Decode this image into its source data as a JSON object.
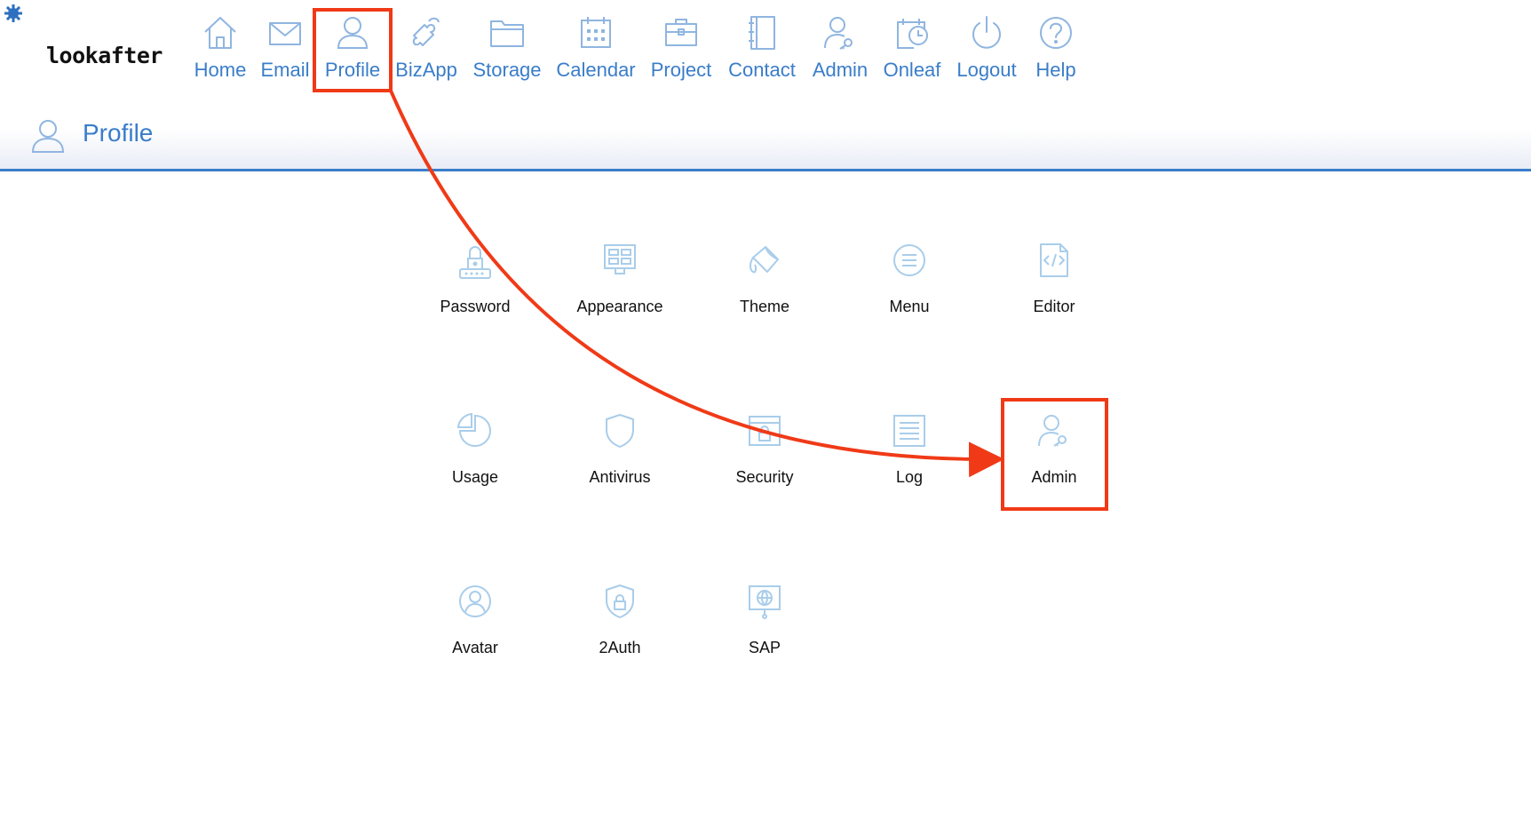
{
  "app": {
    "logo": "lookafter"
  },
  "nav": {
    "items": [
      {
        "label": "Home",
        "icon": "home-icon"
      },
      {
        "label": "Email",
        "icon": "envelope-icon"
      },
      {
        "label": "Profile",
        "icon": "user-icon"
      },
      {
        "label": "BizApp",
        "icon": "puzzle-icon"
      },
      {
        "label": "Storage",
        "icon": "folder-icon"
      },
      {
        "label": "Calendar",
        "icon": "calendar-icon"
      },
      {
        "label": "Project",
        "icon": "briefcase-icon"
      },
      {
        "label": "Contact",
        "icon": "address-book-icon"
      },
      {
        "label": "Admin",
        "icon": "user-key-icon"
      },
      {
        "label": "Onleaf",
        "icon": "calendar-clock-icon"
      },
      {
        "label": "Logout",
        "icon": "power-icon"
      },
      {
        "label": "Help",
        "icon": "question-icon"
      }
    ]
  },
  "page": {
    "title": "Profile",
    "title_icon": "user-icon"
  },
  "tiles": [
    {
      "label": "Password",
      "icon": "password-lock-icon"
    },
    {
      "label": "Appearance",
      "icon": "monitor-layout-icon"
    },
    {
      "label": "Theme",
      "icon": "paint-bucket-icon"
    },
    {
      "label": "Menu",
      "icon": "menu-circle-icon"
    },
    {
      "label": "Editor",
      "icon": "code-file-icon"
    },
    {
      "label": "Usage",
      "icon": "pie-chart-icon"
    },
    {
      "label": "Antivirus",
      "icon": "shield-icon"
    },
    {
      "label": "Security",
      "icon": "browser-lock-icon"
    },
    {
      "label": "Log",
      "icon": "list-document-icon"
    },
    {
      "label": "Admin",
      "icon": "user-key-icon"
    },
    {
      "label": "Avatar",
      "icon": "avatar-circle-icon"
    },
    {
      "label": "2Auth",
      "icon": "shield-lock-icon"
    },
    {
      "label": "SAP",
      "icon": "globe-monitor-icon"
    }
  ],
  "colors": {
    "nav_text": "#3a7dc9",
    "nav_icon": "#8fb5e0",
    "tile_icon": "#a9cdea",
    "annotation": "#f03a17",
    "divider": "#3a7dc9"
  }
}
